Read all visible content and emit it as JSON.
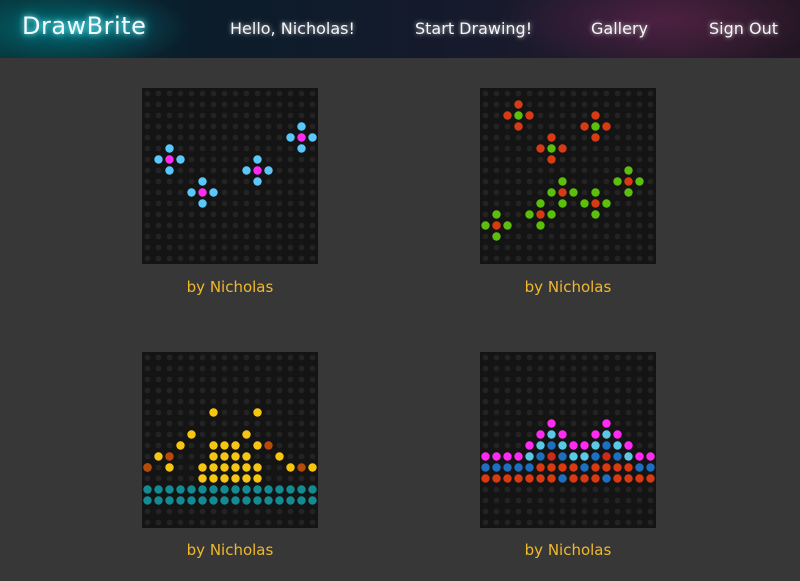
{
  "nav": {
    "brand": "DrawBrite",
    "greeting": "Hello, Nicholas!",
    "start_drawing": "Start Drawing!",
    "gallery": "Gallery",
    "sign_out": "Sign Out"
  },
  "colors": {
    "cyan": "#5ac8fa",
    "magenta": "#ff2bf2",
    "red": "#d93a12",
    "green": "#5cbf0d",
    "yellow": "#f7c613",
    "orange": "#b84b09",
    "teal": "#138b93",
    "blue": "#1d6fc2",
    "light_blue": "#5ac8e6",
    "dark_red": "#cc2a1a"
  },
  "gallery": [
    {
      "caption": "by Nicholas"
    },
    {
      "caption": "by Nicholas"
    },
    {
      "caption": "by Nicholas"
    },
    {
      "caption": "by Nicholas"
    }
  ]
}
